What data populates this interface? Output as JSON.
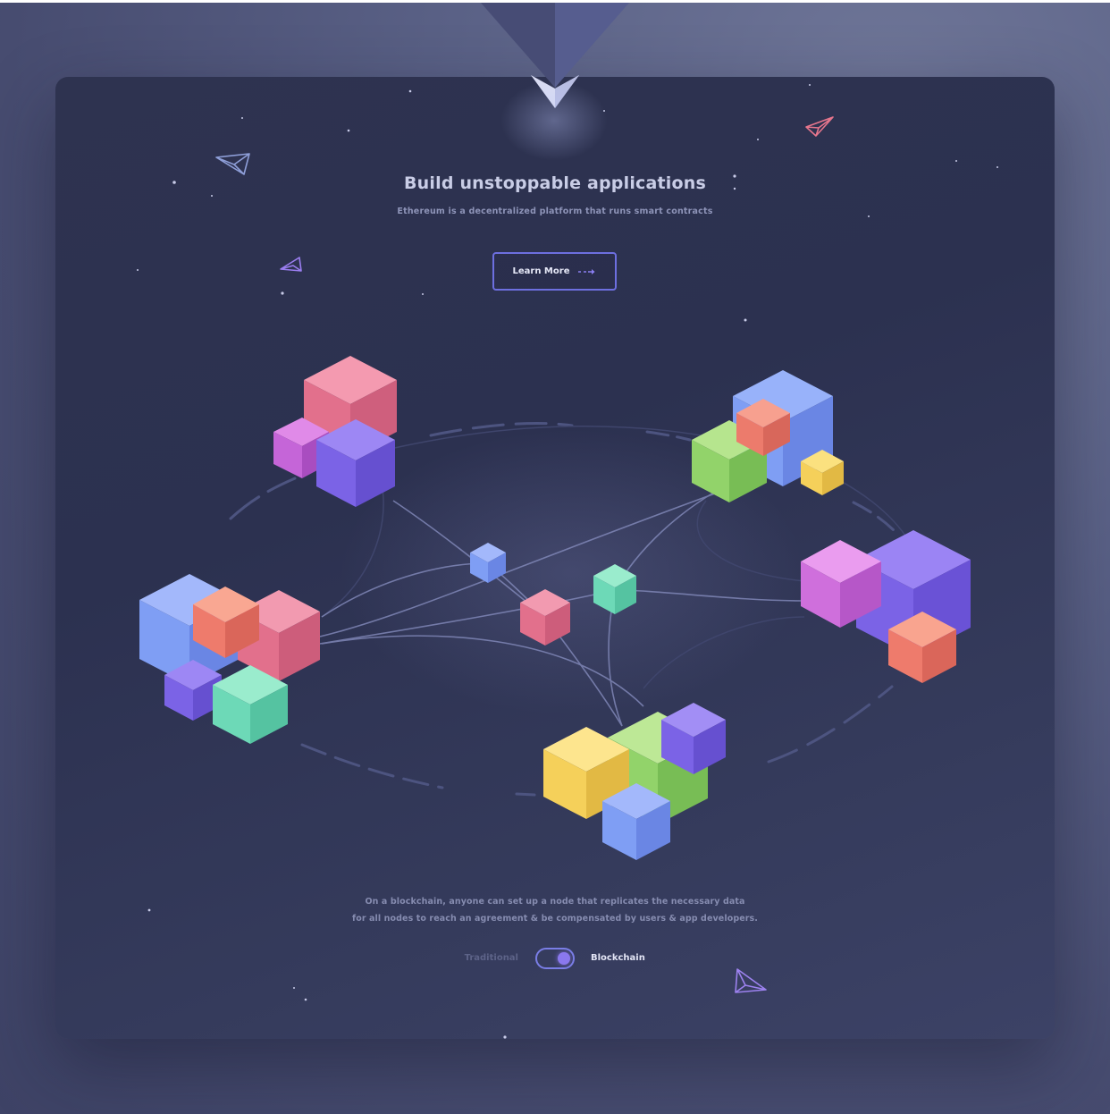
{
  "hero": {
    "title": "Build unstoppable applications",
    "subtitle": "Ethereum is a decentralized platform that runs smart contracts",
    "cta_label": "Learn More"
  },
  "description": {
    "line1": "On a blockchain, anyone can set up a node that replicates the necessary data",
    "line2": "for all nodes to reach an agreement & be compensated by users & app developers."
  },
  "toggle": {
    "left_label": "Traditional",
    "right_label": "Blockchain",
    "selected": "Blockchain"
  },
  "colors": {
    "accent": "#6d6fe0",
    "cube_pink": "#e9738f",
    "cube_purple": "#7b63e6",
    "cube_magenta": "#c565d8",
    "cube_blue": "#6f8ff2",
    "cube_coral": "#ee7b6c",
    "cube_green": "#8fd46a",
    "cube_teal": "#66d8b7",
    "cube_yellow": "#f5d05a"
  },
  "icons": [
    "ethereum-logo-icon",
    "paper-plane-icon",
    "arrow-right-icon",
    "cube-icon"
  ]
}
